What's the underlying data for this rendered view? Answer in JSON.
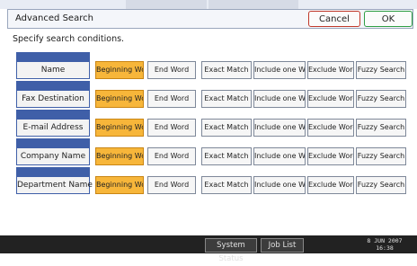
{
  "window": {
    "title": "Advanced Search",
    "cancel_label": "Cancel",
    "ok_label": "OK"
  },
  "instruction": "Specify search conditions.",
  "options": [
    "Beginning Word",
    "End Word",
    "Exact Match",
    "Include one Word",
    "Exclude Words",
    "Fuzzy Search"
  ],
  "selected_option": "Beginning Word",
  "fields": [
    {
      "label": "Name",
      "selected": "Beginning Word"
    },
    {
      "label": "Fax Destination",
      "selected": "Beginning Word"
    },
    {
      "label": "E-mail Address",
      "selected": "Beginning Word"
    },
    {
      "label": "Company Name",
      "selected": "Beginning Word"
    },
    {
      "label": "Department Name",
      "selected": "Beginning Word"
    }
  ],
  "status_bar": {
    "system_status_label": "System Status",
    "job_list_label": "Job List",
    "date": "8 JUN 2007",
    "time": "16:38"
  },
  "colors": {
    "selected_option": "#f7b63a",
    "field_accent": "#3f5fa8",
    "cancel_border": "#c0392b",
    "ok_border": "#2e9e44"
  }
}
